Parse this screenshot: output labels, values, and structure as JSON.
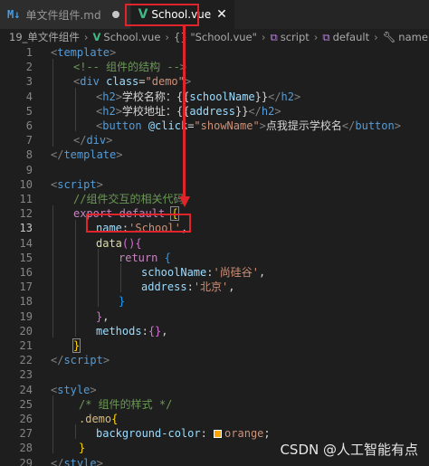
{
  "tabs": [
    {
      "icon": "M↓",
      "label": "单文件组件.md",
      "active": false,
      "modified": true
    },
    {
      "icon": "V",
      "label": "School.vue",
      "active": true
    }
  ],
  "breadcrumb": {
    "folder": "19_单文件组件",
    "file": "School.vue",
    "sym1": "{} \"School.vue\"",
    "sym2": "script",
    "sym3": "default",
    "sym4": "name"
  },
  "code_lines": [
    {
      "n": "1"
    },
    {
      "n": "2"
    },
    {
      "n": "3"
    },
    {
      "n": "4"
    },
    {
      "n": "5"
    },
    {
      "n": "6"
    },
    {
      "n": "7"
    },
    {
      "n": "8"
    },
    {
      "n": "9"
    },
    {
      "n": "10"
    },
    {
      "n": "11"
    },
    {
      "n": "12"
    },
    {
      "n": "13"
    },
    {
      "n": "14"
    },
    {
      "n": "15"
    },
    {
      "n": "16"
    },
    {
      "n": "17"
    },
    {
      "n": "18"
    },
    {
      "n": "19"
    },
    {
      "n": "20"
    },
    {
      "n": "21"
    },
    {
      "n": "22"
    },
    {
      "n": "23"
    },
    {
      "n": "24"
    },
    {
      "n": "25"
    },
    {
      "n": "26"
    },
    {
      "n": "27"
    },
    {
      "n": "28"
    },
    {
      "n": "29"
    }
  ],
  "code": {
    "l1": "template",
    "l2_comment": "<!-- 组件的结构 -->",
    "l3_tag": "div",
    "l3_attr": "class",
    "l3_val": "\"demo\"",
    "l4_tag": "h2",
    "l4_text": "学校名称：",
    "l4_expr": "schoolName",
    "l5_tag": "h2",
    "l5_text": "学校地址：",
    "l5_expr": "address",
    "l6_tag": "button",
    "l6_attr": "@click",
    "l6_val": "\"showName\"",
    "l6_text": "点我提示学校名",
    "l7_tag": "div",
    "l8_tag": "template",
    "l10_tag": "script",
    "l11_comment": "//组件交互的相关代码",
    "l12_kw1": "export",
    "l12_kw2": "default",
    "l13_prop": "name",
    "l13_val": "'School'",
    "l14_fn": "data",
    "l15_kw": "return",
    "l16_prop": "schoolName",
    "l16_val": "'尚硅谷'",
    "l17_prop": "address",
    "l17_val": "'北京'",
    "l20_prop": "methods",
    "l22_tag": "script",
    "l24_tag": "style",
    "l25_comment": "/* 组件的样式 */",
    "l26_sel": ".demo",
    "l27_prop": "background-color",
    "l27_val": "orange",
    "l29_tag": "style"
  },
  "watermark": "CSDN @人工智能有点",
  "colors": {
    "annotation": "#e0242c",
    "swatch": "#ffa500"
  }
}
